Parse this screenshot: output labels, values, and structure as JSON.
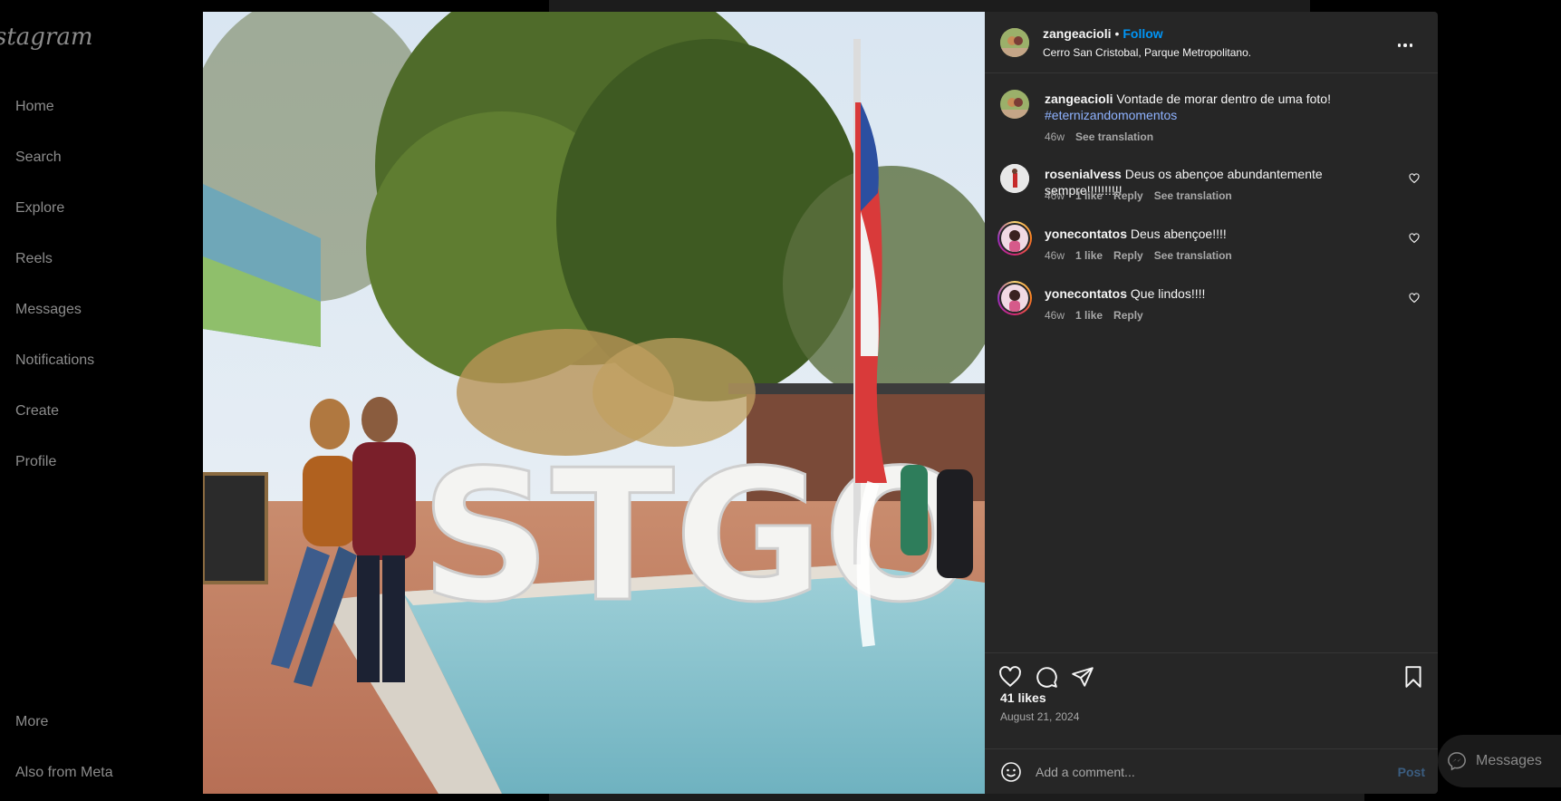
{
  "sidebar": {
    "logo": "stagram",
    "items": [
      {
        "label": "Home"
      },
      {
        "label": "Search"
      },
      {
        "label": "Explore"
      },
      {
        "label": "Reels"
      },
      {
        "label": "Messages"
      },
      {
        "label": "Notifications"
      },
      {
        "label": "Create"
      },
      {
        "label": "Profile"
      }
    ],
    "more": "More",
    "meta": "Also from Meta"
  },
  "post": {
    "author": "zangeacioli",
    "follow_label": "Follow",
    "location": "Cerro San Cristobal, Parque Metropolitano.",
    "sign_text": "STGO",
    "caption": {
      "user": "zangeacioli",
      "text": "Vontade de morar dentro de uma foto!",
      "hashtag": "#eternizandomomentos",
      "age": "46w",
      "translate": "See translation"
    },
    "comments": [
      {
        "user": "rosenialvess",
        "text": "Deus os abençoe abundantemente sempre!!!!!!!!!!",
        "age": "46w",
        "likes": "1 like",
        "reply": "Reply",
        "translate": "See translation"
      },
      {
        "user": "yonecontatos",
        "text": "Deus abençoe!!!!",
        "age": "46w",
        "likes": "1 like",
        "reply": "Reply",
        "translate": "See translation"
      },
      {
        "user": "yonecontatos",
        "text": "Que lindos!!!!",
        "age": "46w",
        "likes": "1 like",
        "reply": "Reply"
      }
    ],
    "likes_label": "41 likes",
    "date": "August 21, 2024",
    "comment_placeholder": "Add a comment...",
    "post_label": "Post"
  },
  "messages_label": "Messages",
  "colors": {
    "panel_bg": "#262626",
    "accent": "#0095f6",
    "muted": "#a8a8a8"
  },
  "icons": [
    "more-icon",
    "heart-icon",
    "comment-icon",
    "share-icon",
    "bookmark-icon",
    "emoji-icon",
    "messenger-icon"
  ]
}
